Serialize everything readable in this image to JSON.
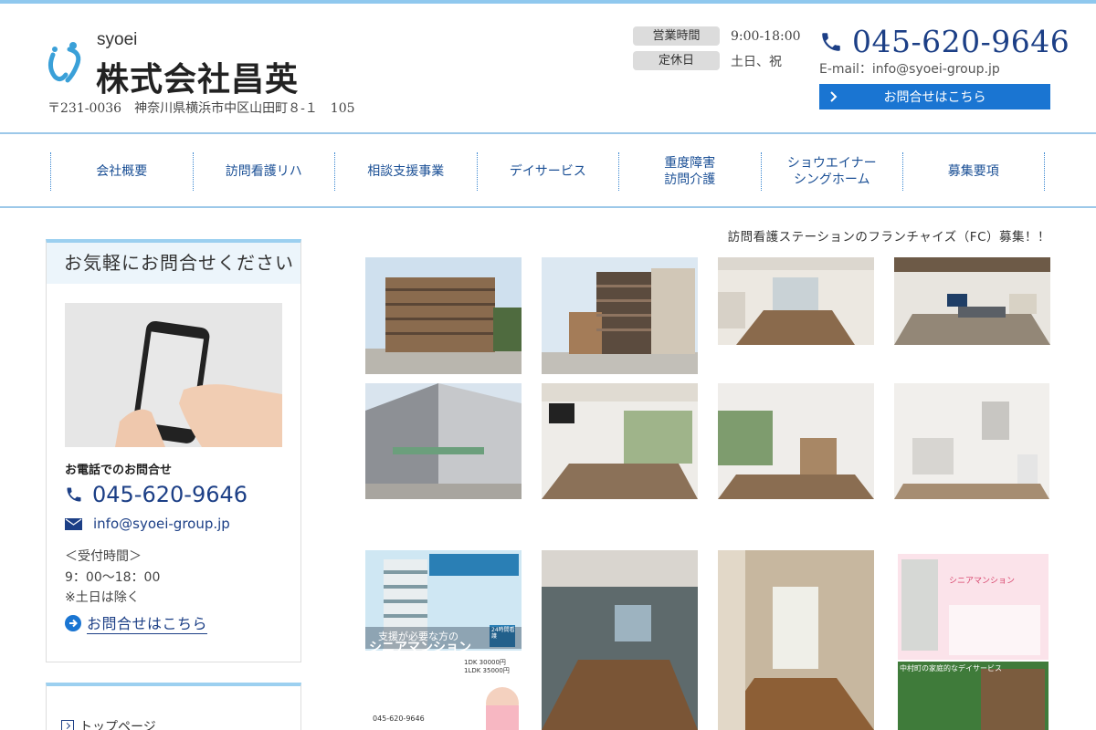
{
  "header": {
    "logo_sub": "syoei",
    "company_name": "株式会社昌英",
    "address": "〒231-0036　神奈川県横浜市中区山田町８-１　105",
    "hours": [
      {
        "tag": "営業時間",
        "value": "9:00-18:00"
      },
      {
        "tag": "定休日",
        "value": "土日、祝"
      }
    ],
    "phone": "045-620-9646",
    "email": "E-mail：info@syoei-group.jp",
    "contact_button": "お問合せはこちら"
  },
  "nav": {
    "items": [
      {
        "label": "会社概要"
      },
      {
        "label": "訪問看護リハ"
      },
      {
        "label": "相談支援事業"
      },
      {
        "label": "デイサービス"
      },
      {
        "label": "重度障害\n訪問介護"
      },
      {
        "label": "ショウエイナー\nシングホーム"
      },
      {
        "label": "募集要項"
      }
    ]
  },
  "sidebar": {
    "heading": "お気軽にお問合せください",
    "phone_heading": "お電話でのお問合せ",
    "phone": "045-620-9646",
    "email": "info@syoei-group.jp",
    "hours_label": "＜受付時間＞",
    "hours_value": "9：00〜18：00",
    "closed_note": "※土日は除く",
    "contact_link": "お問合せはこちら",
    "menu_top": "トップページ"
  },
  "main": {
    "notice": "訪問看護ステーションのフランチャイズ（FC）募集！！",
    "flyer1": {
      "heading": "支援が必要な方の",
      "title": "シニアマンション",
      "badge": "24時間看護",
      "price1": "1DK 30000円",
      "price2": "1LDK 35000円",
      "phone": "045-620-9646"
    },
    "flyer2": {
      "title": "シニアマンション",
      "banner": "中村町の家庭的なデイサービス"
    }
  },
  "colors": {
    "accent_blue": "#1a75d2",
    "navy_text": "#1c3f86",
    "border_light_blue": "#9cc8e9"
  }
}
